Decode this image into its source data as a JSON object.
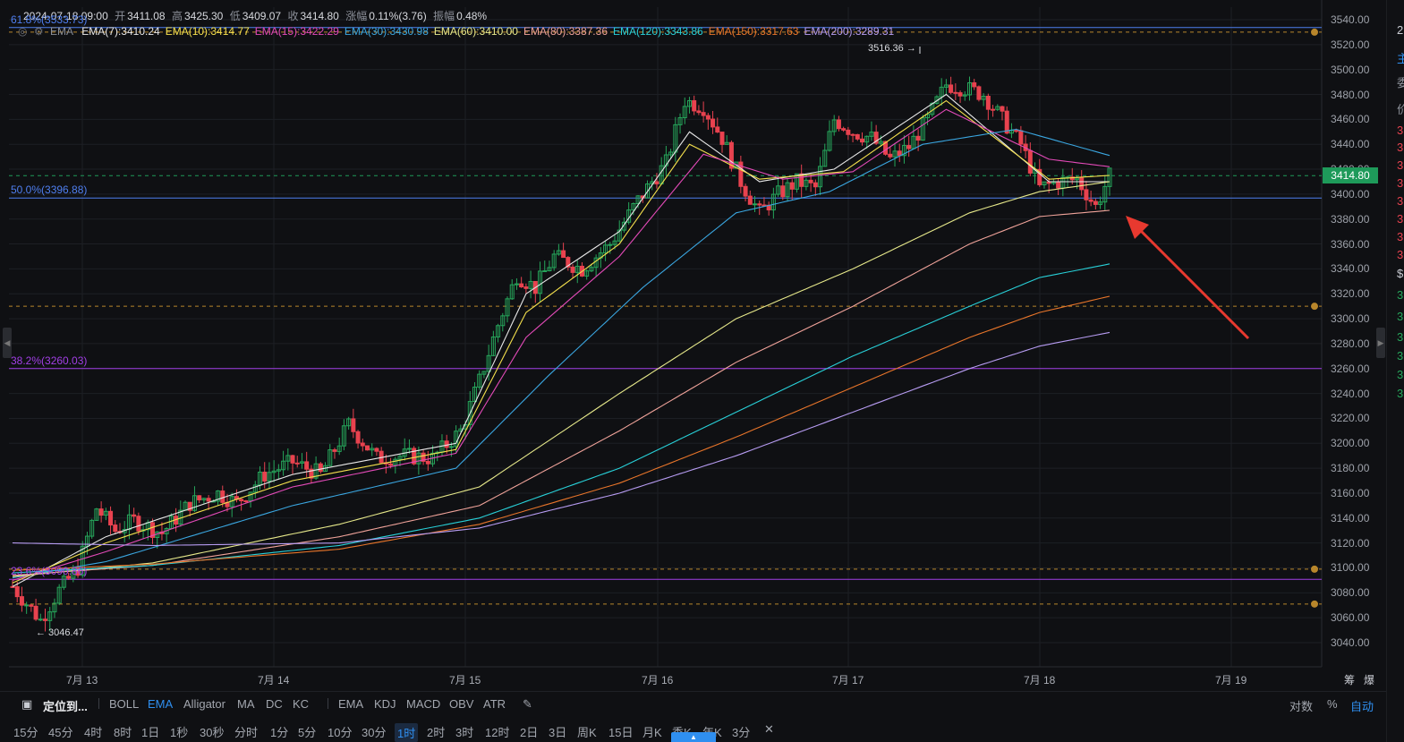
{
  "header": {
    "datetime": "2024-07-18 09:00",
    "open_label": "开",
    "open": "3411.08",
    "high_label": "高",
    "high": "3425.30",
    "low_label": "低",
    "low": "3409.07",
    "close_label": "收",
    "close": "3414.80",
    "change_label": "涨幅",
    "change": "0.11%(3.76)",
    "amplitude_label": "振幅",
    "amplitude": "0.48%"
  },
  "ema_legend": {
    "name": "EMA",
    "items": [
      {
        "text": "EMA(7):3410.24",
        "color": "#e8e8e8"
      },
      {
        "text": "EMA(10):3414.77",
        "color": "#f4e04d"
      },
      {
        "text": "EMA(15):3422.29",
        "color": "#e34ab8"
      },
      {
        "text": "EMA(30):3430.98",
        "color": "#3aa6e0"
      },
      {
        "text": "EMA(60):3410.00",
        "color": "#e6e88a"
      },
      {
        "text": "EMA(80):3387.36",
        "color": "#f0a39a"
      },
      {
        "text": "EMA(120):3343.86",
        "color": "#28d0d8"
      },
      {
        "text": "EMA(150):3317.63",
        "color": "#e8752a"
      },
      {
        "text": "EMA(200):3289.31",
        "color": "#b79cf2"
      }
    ]
  },
  "fib": [
    {
      "text": "61.8%(3533.73)",
      "price": 3533.73,
      "color": "#4f7ff0"
    },
    {
      "text": "50.0%(3396.88)",
      "price": 3396.88,
      "color": "#4f7ff0"
    },
    {
      "text": "38.2%(3260.03)",
      "price": 3260.03,
      "color": "#a23fe6"
    },
    {
      "text": "23.6%(3090.86)",
      "price": 3090.86,
      "color": "#a23fe6"
    }
  ],
  "horizontal_dashed": [
    3530,
    3310,
    3099,
    3071,
    3414.8
  ],
  "annotations": {
    "high_marker": "3516.36 →",
    "low_marker": "← 3046.47",
    "last_price": "3414.80"
  },
  "yaxis": {
    "labels": [
      "3540.00",
      "3520.00",
      "3500.00",
      "3480.00",
      "3460.00",
      "3440.00",
      "3420.00",
      "3400.00",
      "3380.00",
      "3360.00",
      "3340.00",
      "3320.00",
      "3300.00",
      "3280.00",
      "3260.00",
      "3240.00",
      "3220.00",
      "3200.00",
      "3180.00",
      "3160.00",
      "3140.00",
      "3120.00",
      "3100.00",
      "3080.00",
      "3060.00",
      "3040.00"
    ]
  },
  "xaxis": {
    "labels": [
      "7月 13",
      "7月 14",
      "7月 15",
      "7月 16",
      "7月 17",
      "7月 18",
      "7月 19"
    ],
    "right_labels": [
      "筹",
      "爆"
    ]
  },
  "toolbar": {
    "locate": "定位到...",
    "indicators_main": [
      "BOLL",
      "EMA",
      "Alligator",
      "MA",
      "DC",
      "KC"
    ],
    "active_main": "EMA",
    "indicators_sub": [
      "EMA",
      "KDJ",
      "MACD",
      "OBV",
      "ATR"
    ],
    "right": [
      "对数",
      "%",
      "自动"
    ]
  },
  "periods": {
    "items": [
      "15分",
      "45分",
      "4时",
      "8时",
      "1日",
      "1秒",
      "30秒",
      "分时",
      "1分",
      "5分",
      "10分",
      "30分",
      "1时",
      "2时",
      "3时",
      "12时",
      "2日",
      "3日",
      "周K",
      "15日",
      "月K",
      "季K",
      "年K",
      "3分"
    ],
    "active": "1时"
  },
  "right_strip": {
    "chars": [
      "2",
      "主",
      "委",
      "价",
      "3",
      "3",
      "3",
      "3",
      "3",
      "3",
      "3",
      "3",
      "$",
      "3",
      "3",
      "3",
      "3",
      "3",
      "3"
    ]
  },
  "chart_data": {
    "type": "candlestick",
    "ylim": [
      3030,
      3548
    ],
    "xlabels": [
      "7月 13",
      "7月 14",
      "7月 15",
      "7月 16",
      "7月 17",
      "7月 18",
      "7月 19"
    ],
    "up_color": "#26a65b",
    "down_color": "#e8424f",
    "anchors_close": [
      [
        0,
        3085
      ],
      [
        6,
        3058
      ],
      [
        10,
        3082
      ],
      [
        14,
        3100
      ],
      [
        18,
        3148
      ],
      [
        22,
        3130
      ],
      [
        26,
        3138
      ],
      [
        32,
        3128
      ],
      [
        38,
        3152
      ],
      [
        44,
        3160
      ],
      [
        48,
        3152
      ],
      [
        54,
        3175
      ],
      [
        60,
        3185
      ],
      [
        66,
        3175
      ],
      [
        72,
        3215
      ],
      [
        78,
        3188
      ],
      [
        84,
        3190
      ],
      [
        90,
        3188
      ],
      [
        96,
        3210
      ],
      [
        100,
        3250
      ],
      [
        104,
        3295
      ],
      [
        108,
        3335
      ],
      [
        112,
        3325
      ],
      [
        116,
        3350
      ],
      [
        122,
        3340
      ],
      [
        128,
        3360
      ],
      [
        134,
        3395
      ],
      [
        140,
        3425
      ],
      [
        144,
        3475
      ],
      [
        148,
        3470
      ],
      [
        152,
        3445
      ],
      [
        156,
        3410
      ],
      [
        160,
        3385
      ],
      [
        164,
        3400
      ],
      [
        168,
        3410
      ],
      [
        172,
        3405
      ],
      [
        176,
        3460
      ],
      [
        180,
        3450
      ],
      [
        184,
        3445
      ],
      [
        188,
        3428
      ],
      [
        192,
        3438
      ],
      [
        196,
        3460
      ],
      [
        200,
        3488
      ],
      [
        204,
        3485
      ],
      [
        208,
        3480
      ],
      [
        212,
        3460
      ],
      [
        216,
        3440
      ],
      [
        220,
        3405
      ],
      [
        224,
        3410
      ],
      [
        228,
        3412
      ],
      [
        232,
        3390
      ],
      [
        235,
        3414.8
      ]
    ],
    "ema_series": [
      {
        "name": "EMA(7)",
        "color": "#e8e8e8",
        "pts": [
          [
            0,
            3085
          ],
          [
            20,
            3125
          ],
          [
            60,
            3175
          ],
          [
            95,
            3200
          ],
          [
            110,
            3320
          ],
          [
            130,
            3370
          ],
          [
            145,
            3450
          ],
          [
            160,
            3410
          ],
          [
            176,
            3420
          ],
          [
            200,
            3480
          ],
          [
            222,
            3410
          ],
          [
            235,
            3410
          ]
        ]
      },
      {
        "name": "EMA(10)",
        "color": "#f4e04d",
        "pts": [
          [
            0,
            3088
          ],
          [
            20,
            3120
          ],
          [
            60,
            3170
          ],
          [
            95,
            3195
          ],
          [
            110,
            3305
          ],
          [
            130,
            3360
          ],
          [
            145,
            3440
          ],
          [
            160,
            3412
          ],
          [
            178,
            3418
          ],
          [
            200,
            3475
          ],
          [
            222,
            3412
          ],
          [
            235,
            3415
          ]
        ]
      },
      {
        "name": "EMA(15)",
        "color": "#e34ab8",
        "pts": [
          [
            0,
            3090
          ],
          [
            20,
            3113
          ],
          [
            60,
            3165
          ],
          [
            95,
            3192
          ],
          [
            110,
            3285
          ],
          [
            130,
            3350
          ],
          [
            148,
            3432
          ],
          [
            165,
            3412
          ],
          [
            180,
            3418
          ],
          [
            200,
            3468
          ],
          [
            222,
            3428
          ],
          [
            235,
            3422
          ]
        ]
      },
      {
        "name": "EMA(30)",
        "color": "#3aa6e0",
        "pts": [
          [
            0,
            3092
          ],
          [
            20,
            3105
          ],
          [
            60,
            3150
          ],
          [
            95,
            3180
          ],
          [
            115,
            3255
          ],
          [
            135,
            3325
          ],
          [
            155,
            3385
          ],
          [
            175,
            3402
          ],
          [
            195,
            3440
          ],
          [
            215,
            3452
          ],
          [
            235,
            3431
          ]
        ]
      },
      {
        "name": "EMA(60)",
        "color": "#e6e88a",
        "pts": [
          [
            0,
            3093
          ],
          [
            30,
            3104
          ],
          [
            70,
            3135
          ],
          [
            100,
            3165
          ],
          [
            130,
            3240
          ],
          [
            155,
            3300
          ],
          [
            180,
            3340
          ],
          [
            205,
            3385
          ],
          [
            220,
            3402
          ],
          [
            235,
            3410
          ]
        ]
      },
      {
        "name": "EMA(80)",
        "color": "#f0a39a",
        "pts": [
          [
            0,
            3094
          ],
          [
            30,
            3102
          ],
          [
            70,
            3125
          ],
          [
            100,
            3150
          ],
          [
            130,
            3210
          ],
          [
            155,
            3265
          ],
          [
            180,
            3310
          ],
          [
            205,
            3360
          ],
          [
            220,
            3382
          ],
          [
            235,
            3387
          ]
        ]
      },
      {
        "name": "EMA(120)",
        "color": "#28d0d8",
        "pts": [
          [
            0,
            3096
          ],
          [
            30,
            3102
          ],
          [
            70,
            3118
          ],
          [
            100,
            3140
          ],
          [
            130,
            3180
          ],
          [
            155,
            3225
          ],
          [
            180,
            3270
          ],
          [
            205,
            3310
          ],
          [
            220,
            3333
          ],
          [
            235,
            3344
          ]
        ]
      },
      {
        "name": "EMA(150)",
        "color": "#e8752a",
        "pts": [
          [
            0,
            3098
          ],
          [
            30,
            3103
          ],
          [
            70,
            3115
          ],
          [
            100,
            3135
          ],
          [
            130,
            3168
          ],
          [
            155,
            3205
          ],
          [
            180,
            3245
          ],
          [
            205,
            3285
          ],
          [
            220,
            3305
          ],
          [
            235,
            3318
          ]
        ]
      },
      {
        "name": "EMA(200)",
        "color": "#b79cf2",
        "pts": [
          [
            0,
            3120
          ],
          [
            30,
            3118
          ],
          [
            70,
            3120
          ],
          [
            100,
            3132
          ],
          [
            130,
            3160
          ],
          [
            155,
            3190
          ],
          [
            180,
            3225
          ],
          [
            205,
            3260
          ],
          [
            220,
            3278
          ],
          [
            235,
            3289
          ]
        ]
      }
    ]
  },
  "colors": {
    "background": "#0f1013",
    "grid": "#1d1f24",
    "accent": "#2f8ff0",
    "arrow": "#e8392f"
  }
}
